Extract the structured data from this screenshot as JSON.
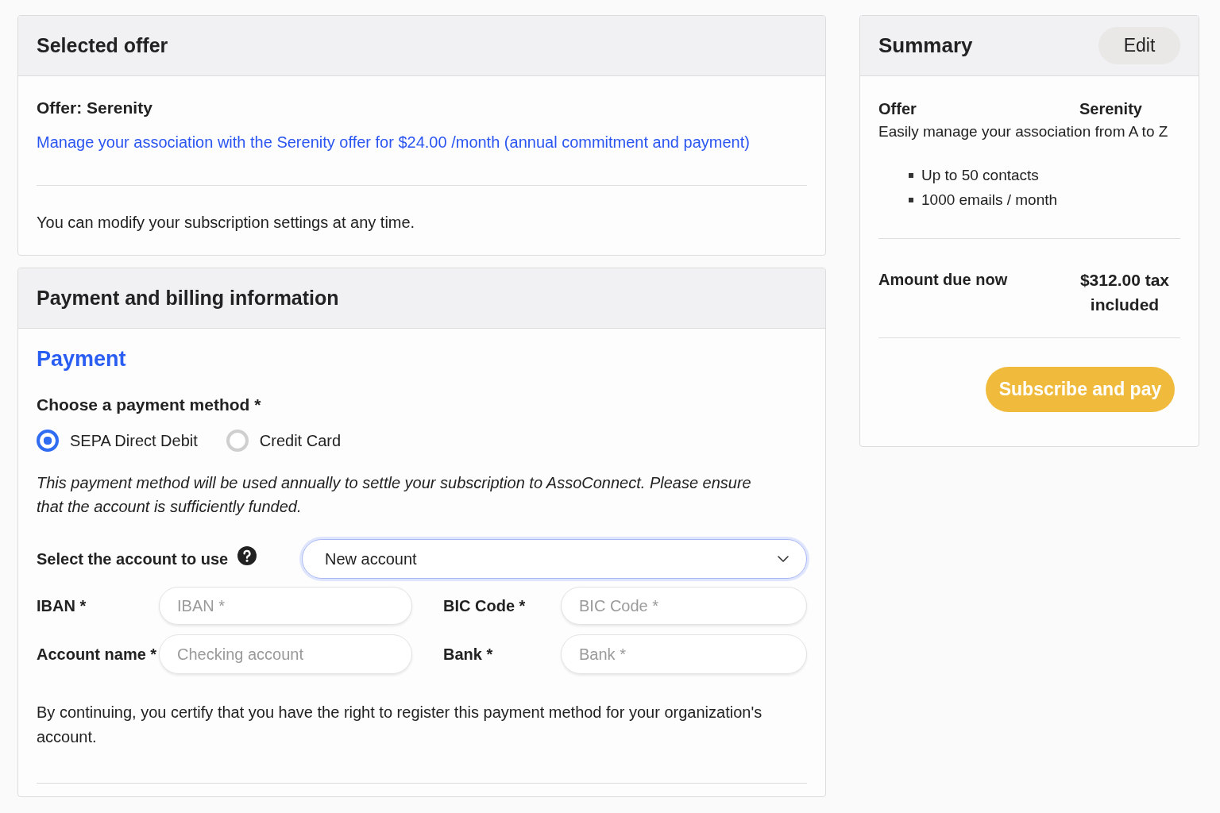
{
  "selected_offer": {
    "title": "Selected offer",
    "offer_name": "Offer: Serenity",
    "offer_link": "Manage your association with the Serenity offer for $24.00 /month (annual commitment and payment)",
    "note": "You can modify your subscription settings at any time."
  },
  "payment_billing": {
    "title": "Payment and billing information",
    "section_title": "Payment",
    "method_label": "Choose a payment method *",
    "methods": [
      {
        "label": "SEPA Direct Debit",
        "selected": true
      },
      {
        "label": "Credit Card",
        "selected": false
      }
    ],
    "method_note": "This payment method will be used annually to settle your subscription to AssoConnect. Please ensure that the account is sufficiently funded.",
    "account_select": {
      "label": "Select the account to use",
      "value": "New account",
      "focused": true
    },
    "fields": [
      {
        "label": "IBAN *",
        "placeholder": "IBAN *"
      },
      {
        "label": "BIC Code *",
        "placeholder": "BIC Code *"
      },
      {
        "label": "Account name *",
        "placeholder": "Checking account"
      },
      {
        "label": "Bank *",
        "placeholder": "Bank *"
      }
    ],
    "certification": "By continuing, you certify that you have the right to register this payment method for your organization's account."
  },
  "summary": {
    "title": "Summary",
    "edit_button": "Edit",
    "offer_label": "Offer",
    "offer_value": "Serenity",
    "offer_description": "Easily manage your association from A to Z",
    "features": [
      "Up to 50 contacts",
      "1000 emails / month"
    ],
    "amount_label": "Amount due now",
    "amount_value": "$312.00 tax included",
    "pay_button": "Subscribe and pay"
  }
}
